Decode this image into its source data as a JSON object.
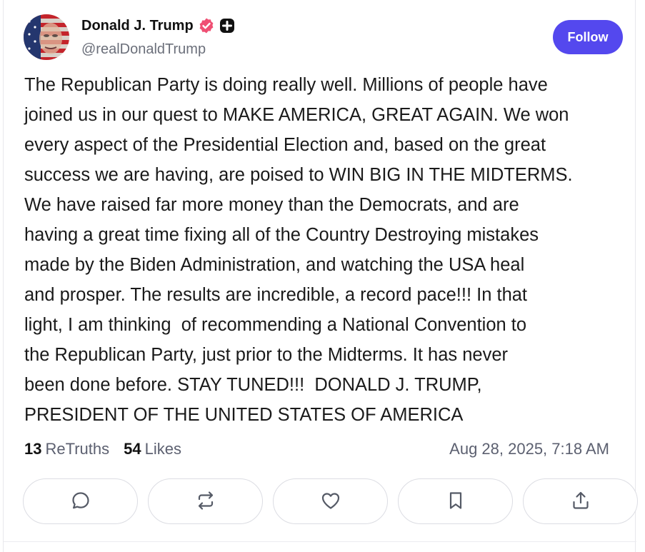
{
  "author": {
    "display_name": "Donald J. Trump",
    "handle": "@realDonaldTrump"
  },
  "follow_label": "Follow",
  "post": {
    "text": "The Republican Party is doing really well. Millions of people have\njoined us in our quest to MAKE AMERICA, GREAT AGAIN. We won\nevery aspect of the Presidential Election and, based on the great\nsuccess we are having, are poised to WIN BIG IN THE MIDTERMS.\nWe have raised far more money than the Democrats, and are\nhaving a great time fixing all of the Country Destroying mistakes\nmade by the Biden Administration, and watching the USA heal\nand prosper. The results are incredible, a record pace!!! In that\nlight, I am thinking  of recommending a National Convention to\nthe Republican Party, just prior to the Midterms. It has never\nbeen done before. STAY TUNED!!!  DONALD J. TRUMP,\nPRESIDENT OF THE UNITED STATES OF AMERICA"
  },
  "stats": {
    "retruths_count": "13",
    "retruths_label": "ReTruths",
    "likes_count": "54",
    "likes_label": "Likes",
    "timestamp": "Aug 28, 2025, 7:18 AM"
  },
  "actions": [
    {
      "icon": "reply-icon"
    },
    {
      "icon": "retruth-icon"
    },
    {
      "icon": "heart-icon"
    },
    {
      "icon": "bookmark-icon"
    },
    {
      "icon": "share-icon"
    }
  ],
  "colors": {
    "accent": "#5448ee",
    "verified": "#ef4f73",
    "muted_text": "#5c6070"
  }
}
